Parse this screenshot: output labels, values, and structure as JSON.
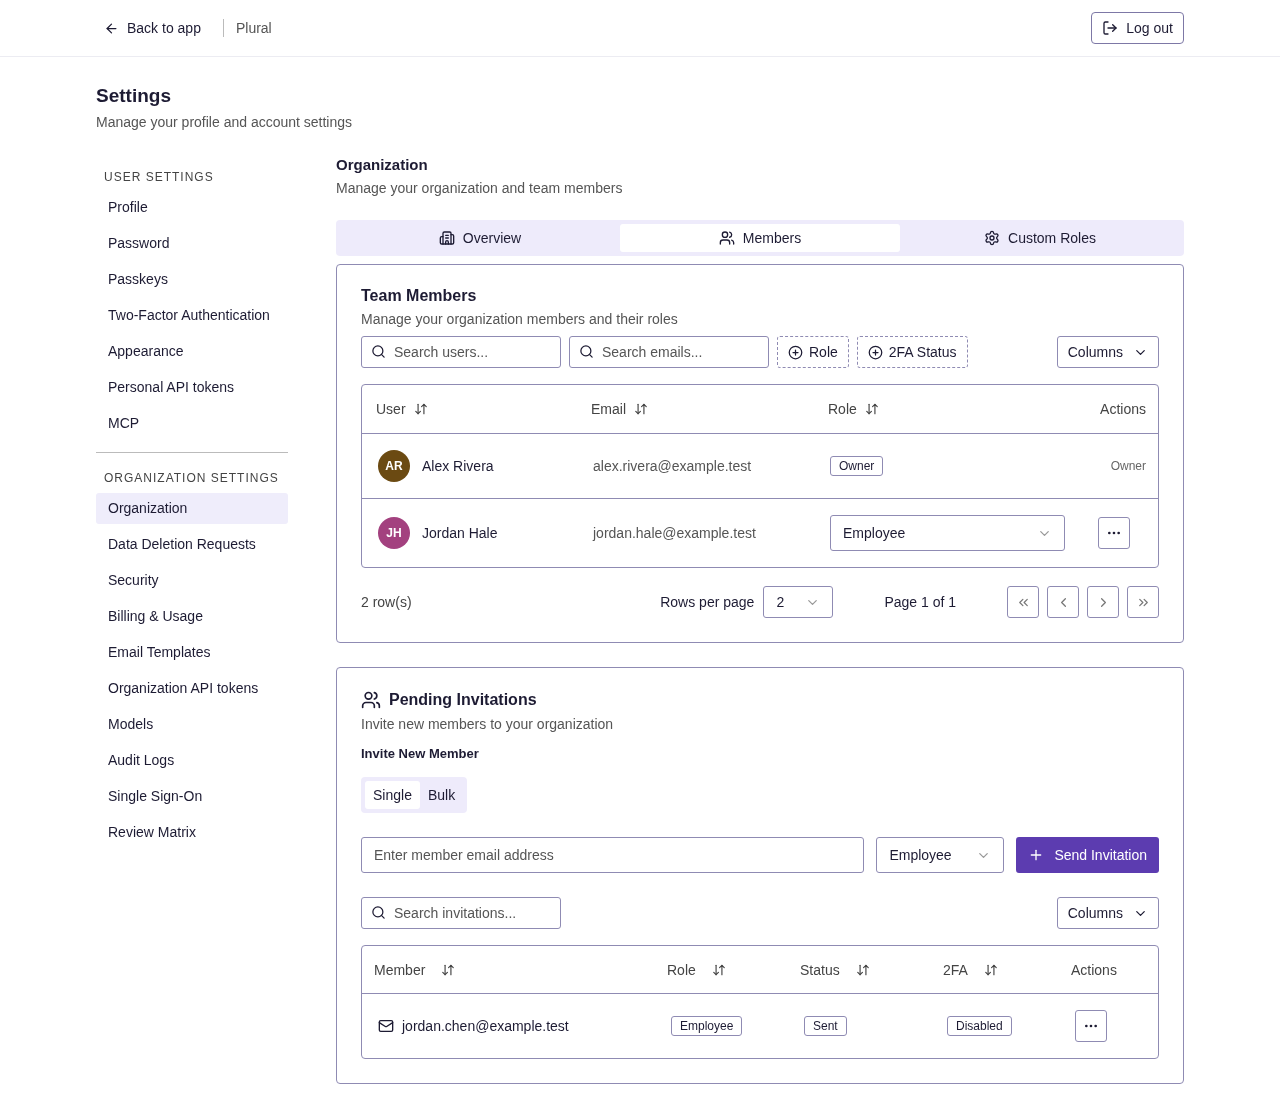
{
  "header": {
    "back": "Back to app",
    "app_name": "Plural",
    "logout": "Log out"
  },
  "page": {
    "title": "Settings",
    "subtitle": "Manage your profile and account settings"
  },
  "sidebar": {
    "sections": [
      {
        "heading": "USER SETTINGS",
        "items": [
          {
            "label": "Profile",
            "selected": false
          },
          {
            "label": "Password",
            "selected": false
          },
          {
            "label": "Passkeys",
            "selected": false
          },
          {
            "label": "Two-Factor Authentication",
            "selected": false
          },
          {
            "label": "Appearance",
            "selected": false
          },
          {
            "label": "Personal API tokens",
            "selected": false
          },
          {
            "label": "MCP",
            "selected": false
          }
        ]
      },
      {
        "heading": "ORGANIZATION SETTINGS",
        "items": [
          {
            "label": "Organization",
            "selected": true
          },
          {
            "label": "Data Deletion Requests",
            "selected": false
          },
          {
            "label": "Security",
            "selected": false
          },
          {
            "label": "Billing & Usage",
            "selected": false
          },
          {
            "label": "Email Templates",
            "selected": false
          },
          {
            "label": "Organization API tokens",
            "selected": false
          },
          {
            "label": "Models",
            "selected": false
          },
          {
            "label": "Audit Logs",
            "selected": false
          },
          {
            "label": "Single Sign-On",
            "selected": false
          },
          {
            "label": "Review Matrix",
            "selected": false
          }
        ]
      }
    ]
  },
  "section": {
    "title": "Organization",
    "subtitle": "Manage your organization and team members"
  },
  "tabs": [
    {
      "label": "Overview",
      "kind": "overview",
      "selected": false
    },
    {
      "label": "Members",
      "kind": "members",
      "selected": true
    },
    {
      "label": "Custom Roles",
      "kind": "roles",
      "selected": false
    }
  ],
  "team": {
    "title": "Team Members",
    "subtitle": "Manage your organization members and their roles",
    "search_users": {
      "placeholder": "Search users..."
    },
    "search_emails": {
      "placeholder": "Search emails..."
    },
    "filters": [
      "Role",
      "2FA Status"
    ],
    "columns_button": "Columns",
    "table": {
      "columns": [
        {
          "label": "User",
          "sortable": true
        },
        {
          "label": "Email",
          "sortable": true
        },
        {
          "label": "Role",
          "sortable": true
        },
        {
          "label": "Actions",
          "sortable": false
        }
      ],
      "rows": [
        {
          "initials": "AR",
          "color": "#6b4a12",
          "name": "Alex Rivera",
          "email": "alex.rivera@example.test",
          "role": {
            "kind": "badge",
            "text": "Owner"
          },
          "action": {
            "kind": "text",
            "text": "Owner"
          }
        },
        {
          "initials": "JH",
          "color": "#a3417f",
          "name": "Jordan Hale",
          "email": "jordan.hale@example.test",
          "role": {
            "kind": "select",
            "text": "Employee"
          },
          "action": {
            "kind": "menu"
          }
        }
      ]
    },
    "row_count": "2 row(s)",
    "rows_per_page_label": "Rows per page",
    "rows_per_page": "2",
    "page_label": "Page 1 of 1"
  },
  "invitations": {
    "title": "Pending Invitations",
    "subtitle": "Invite new members to your organization",
    "form_label": "Invite New Member",
    "modes": [
      {
        "label": "Single",
        "selected": true
      },
      {
        "label": "Bulk",
        "selected": false
      }
    ],
    "email": {
      "placeholder": "Enter member email address"
    },
    "role": "Employee",
    "send_button": "Send Invitation",
    "search": {
      "placeholder": "Search invitations..."
    },
    "columns_button": "Columns",
    "table": {
      "columns": [
        {
          "label": "Member",
          "sortable": true
        },
        {
          "label": "Role",
          "sortable": true
        },
        {
          "label": "Status",
          "sortable": true
        },
        {
          "label": "2FA",
          "sortable": true
        },
        {
          "label": "Actions",
          "sortable": false
        }
      ],
      "rows": [
        {
          "email": "jordan.chen@example.test",
          "role": "Employee",
          "status": "Sent",
          "twofa": "Disabled"
        }
      ]
    }
  }
}
